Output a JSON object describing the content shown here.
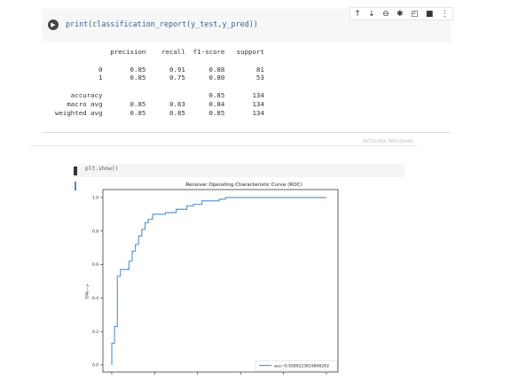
{
  "cell1": {
    "run_icon": "play-icon",
    "code": "print(classification_report(y_test,y_pred))",
    "toolbar": [
      {
        "name": "move-up-icon",
        "glyph": "↑"
      },
      {
        "name": "move-down-icon",
        "glyph": "↓"
      },
      {
        "name": "link-icon",
        "glyph": "⊖"
      },
      {
        "name": "settings-icon",
        "glyph": "✱"
      },
      {
        "name": "mirror-cell-icon",
        "glyph": "◰"
      },
      {
        "name": "delete-icon",
        "glyph": "■"
      },
      {
        "name": "more-icon",
        "glyph": "⋮"
      }
    ],
    "report_text": "              precision    recall  f1-score   support\n\n           0       0.85      0.91      0.88        81\n           1       0.85      0.75      0.80        53\n\n    accuracy                           0.85       134\n   macro avg       0.85      0.83      0.84       134\nweighted avg       0.85      0.85      0.85       134"
  },
  "watermark": "Activate Windows",
  "cell2": {
    "code": "plt.show()"
  },
  "chart_data": {
    "type": "line",
    "title": "Receiver Operating Characteristic Curve (ROC)",
    "xlabel": "",
    "ylabel": "TPR--->",
    "ylim": [
      0,
      1
    ],
    "xlim": [
      0,
      1
    ],
    "yticks": [
      "0.0",
      "0.2",
      "0.4",
      "0.6",
      "0.8",
      "1.0"
    ],
    "legend_location": "lower right",
    "colors": {
      "line": "#5b9bd5"
    },
    "series": [
      {
        "name": "auc=0.9280223619846262",
        "x": [
          0,
          0,
          0.013,
          0.013,
          0.026,
          0.026,
          0.04,
          0.04,
          0.08,
          0.08,
          0.095,
          0.095,
          0.11,
          0.11,
          0.125,
          0.125,
          0.14,
          0.14,
          0.155,
          0.155,
          0.17,
          0.17,
          0.19,
          0.19,
          0.25,
          0.25,
          0.3,
          0.3,
          0.35,
          0.35,
          0.38,
          0.38,
          0.42,
          0.42,
          0.5,
          0.5,
          0.53,
          0.53,
          1.0
        ],
        "y": [
          0,
          0.13,
          0.13,
          0.23,
          0.23,
          0.53,
          0.53,
          0.57,
          0.57,
          0.62,
          0.62,
          0.68,
          0.68,
          0.72,
          0.72,
          0.77,
          0.77,
          0.81,
          0.81,
          0.85,
          0.85,
          0.87,
          0.87,
          0.9,
          0.9,
          0.91,
          0.91,
          0.93,
          0.93,
          0.95,
          0.95,
          0.96,
          0.96,
          0.98,
          0.98,
          0.99,
          0.99,
          1.0,
          1.0
        ]
      }
    ]
  }
}
